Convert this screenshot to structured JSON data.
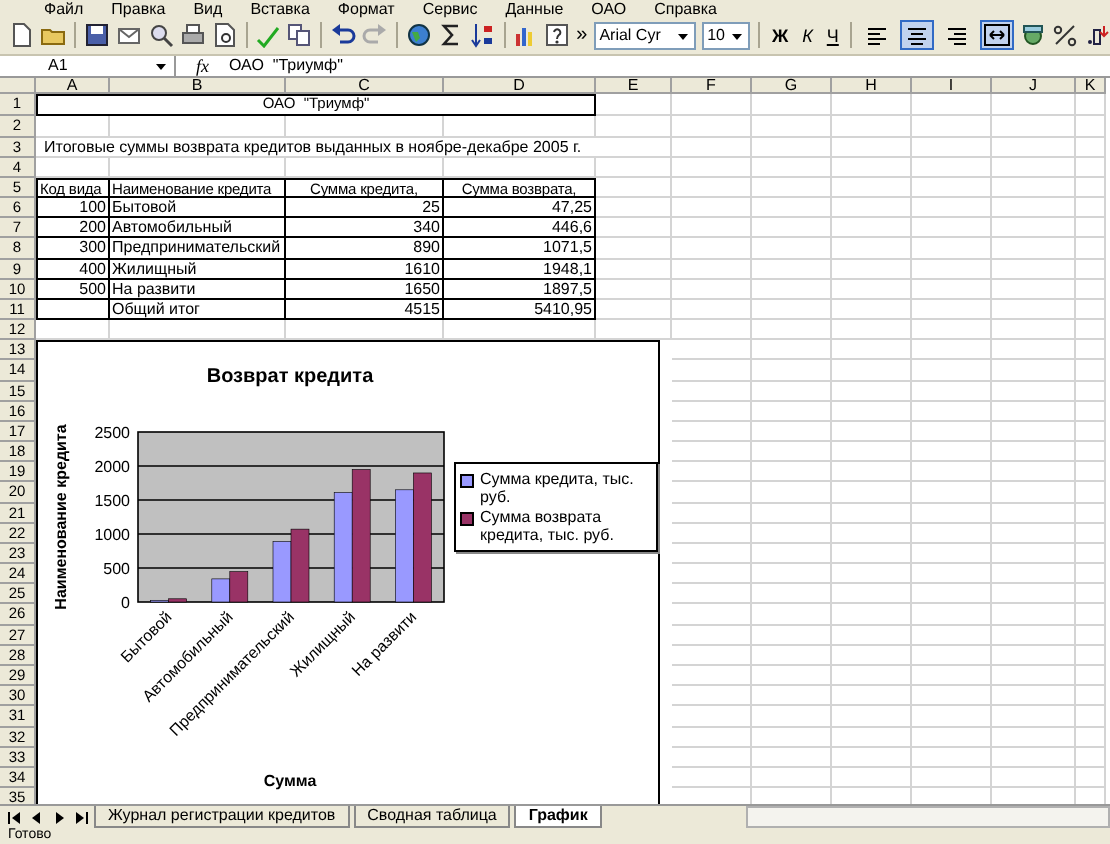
{
  "menu": {
    "items": [
      "Файл",
      "Правка",
      "Вид",
      "Вставка",
      "Формат",
      "Сервис",
      "Данные",
      "ОАО",
      "Справка"
    ]
  },
  "toolbar": {
    "more": "»",
    "font": "Arial Cyr",
    "size": "10",
    "format_buttons": [
      {
        "label": "Ж",
        "kind": "bold"
      },
      {
        "label": "К",
        "kind": "italic"
      },
      {
        "label": "Ч",
        "kind": "underline"
      }
    ],
    "align_buttons": [
      {
        "kind": "left",
        "selected": false
      },
      {
        "kind": "center",
        "selected": true
      },
      {
        "kind": "right",
        "selected": false
      },
      {
        "kind": "merge",
        "selected": true
      }
    ]
  },
  "formula_bar": {
    "name_box": "A1",
    "fx": "fx",
    "value": "ОАО  \"Триумф\""
  },
  "columns": [
    "A",
    "B",
    "C",
    "D",
    "E",
    "F",
    "G",
    "H",
    "I",
    "J",
    "K"
  ],
  "rows": [
    {
      "header": "1",
      "kind": "title",
      "active": true,
      "cells": [
        "ОАО  \"Триумф\""
      ]
    },
    {
      "header": "2",
      "kind": "blank"
    },
    {
      "header": "3",
      "kind": "note",
      "cells": [
        "Итоговые суммы возврата кредитов выданных в ноябре-декабре 2005 г."
      ]
    },
    {
      "header": "4",
      "kind": "blank"
    },
    {
      "header": "5",
      "kind": "table-head",
      "cells": [
        "Код вида",
        "Наименование кредита",
        "Сумма кредита,",
        "Сумма возврата,"
      ]
    },
    {
      "header": "6",
      "kind": "table",
      "cells": [
        "100",
        "Бытовой",
        "25",
        "47,25"
      ]
    },
    {
      "header": "7",
      "kind": "table",
      "cells": [
        "200",
        "Автомобильный",
        "340",
        "446,6"
      ]
    },
    {
      "header": "8",
      "kind": "table",
      "cells": [
        "300",
        "Предпринимательский",
        "890",
        "1071,5"
      ]
    },
    {
      "header": "9",
      "kind": "table",
      "cells": [
        "400",
        "Жилищный",
        "1610",
        "1948,1"
      ]
    },
    {
      "header": "10",
      "kind": "table",
      "cells": [
        "500",
        "На развити",
        "1650",
        "1897,5"
      ]
    },
    {
      "header": "11",
      "kind": "total",
      "cells": [
        "Общий итог",
        "4515",
        "5410,95"
      ]
    },
    {
      "header": "12",
      "kind": "blank"
    },
    {
      "header": "13",
      "kind": "blank"
    },
    {
      "header": "14",
      "kind": "blank"
    },
    {
      "header": "15",
      "kind": "blank"
    },
    {
      "header": "16",
      "kind": "blank"
    },
    {
      "header": "17",
      "kind": "blank"
    },
    {
      "header": "18",
      "kind": "blank"
    },
    {
      "header": "19",
      "kind": "blank"
    },
    {
      "header": "20",
      "kind": "blank"
    },
    {
      "header": "21",
      "kind": "blank"
    },
    {
      "header": "22",
      "kind": "blank"
    },
    {
      "header": "23",
      "kind": "blank"
    },
    {
      "header": "24",
      "kind": "blank"
    },
    {
      "header": "25",
      "kind": "blank"
    },
    {
      "header": "26",
      "kind": "blank"
    },
    {
      "header": "27",
      "kind": "blank"
    },
    {
      "header": "28",
      "kind": "blank"
    },
    {
      "header": "29",
      "kind": "blank"
    },
    {
      "header": "30",
      "kind": "blank"
    },
    {
      "header": "31",
      "kind": "blank"
    },
    {
      "header": "32",
      "kind": "blank"
    },
    {
      "header": "33",
      "kind": "blank"
    },
    {
      "header": "34",
      "kind": "blank"
    },
    {
      "header": "35",
      "kind": "blank"
    }
  ],
  "chart": {
    "chart_data": {
      "type": "bar",
      "title": "Возврат кредита",
      "xlabel": "Сумма",
      "ylabel": "Наименование кредита",
      "categories": [
        "Бытовой",
        "Автомобильный",
        "Предпринимательский",
        "Жилищный",
        "На развити"
      ],
      "series": [
        {
          "name": "Сумма кредита, тыс. руб.",
          "color": "#9999ff",
          "values": [
            25,
            340,
            890,
            1610,
            1650
          ]
        },
        {
          "name": "Сумма возврата кредита, тыс. руб.",
          "color": "#993366",
          "values": [
            47.25,
            446.6,
            1071.5,
            1948.1,
            1897.5
          ]
        }
      ],
      "ylim": [
        0,
        2500
      ],
      "yticks": [
        0,
        500,
        1000,
        1500,
        2000,
        2500
      ],
      "grid": true,
      "legend": "right"
    }
  },
  "sheet_tabs": [
    {
      "label": "Журнал регистрации кредитов",
      "selected": false
    },
    {
      "label": "Сводная таблица",
      "selected": false
    },
    {
      "label": "График",
      "selected": true
    }
  ],
  "status_bar": {
    "text": "Готово"
  }
}
